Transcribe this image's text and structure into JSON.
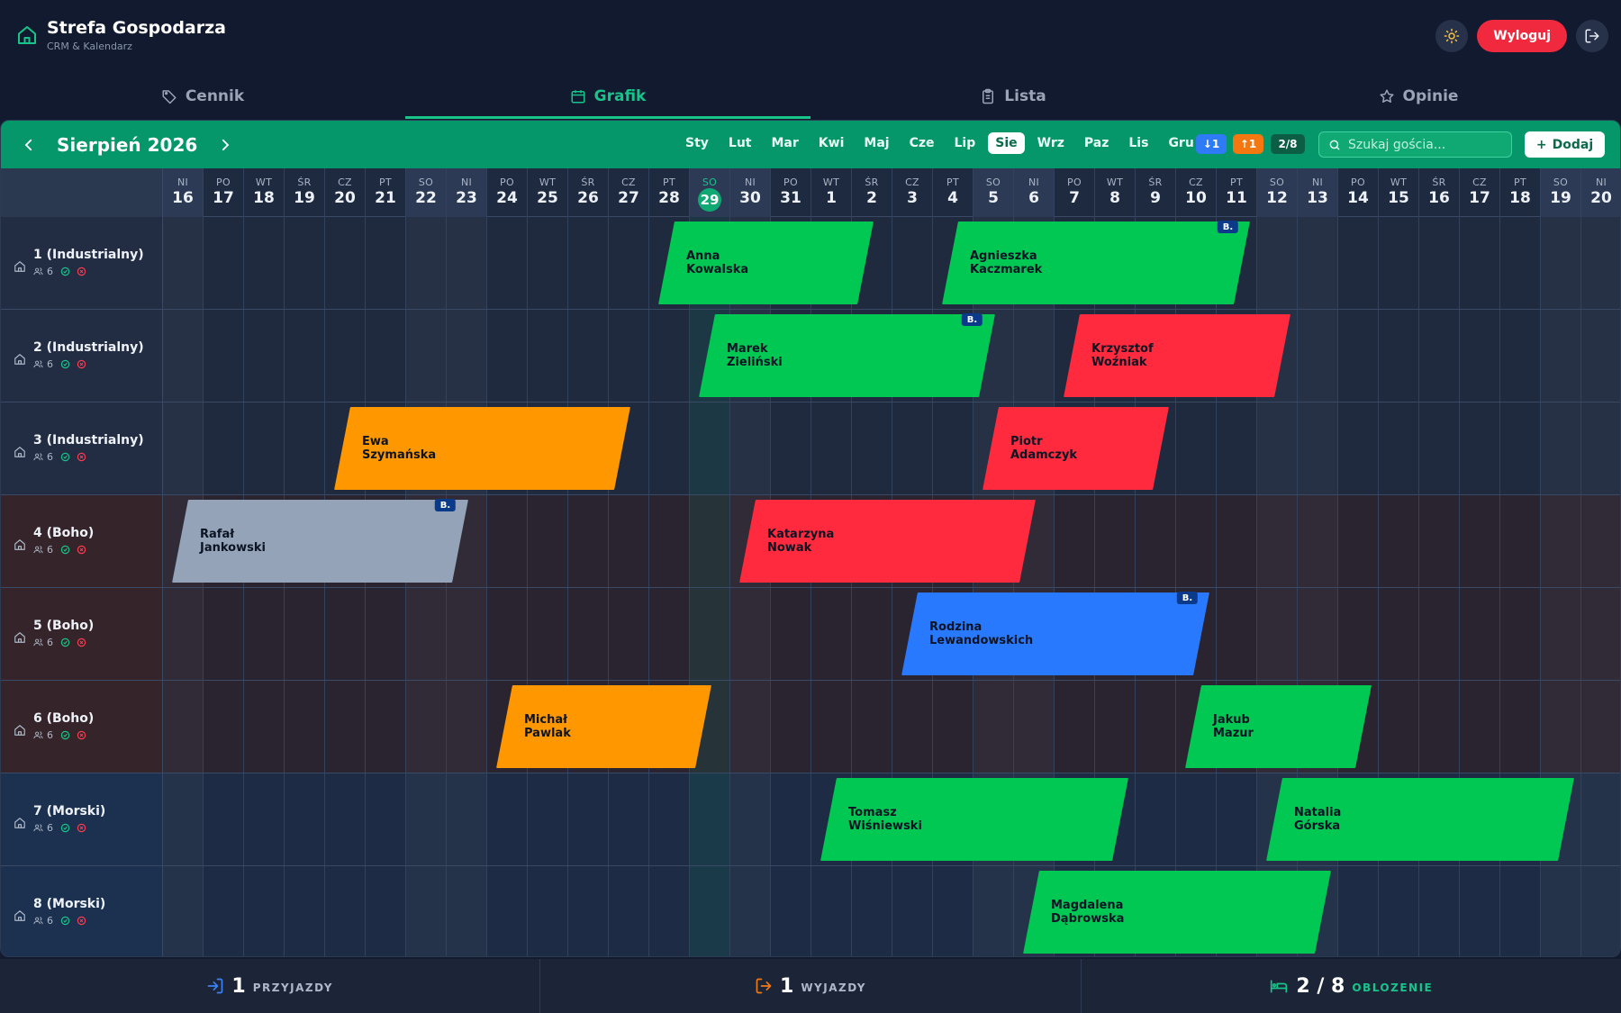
{
  "app": {
    "title": "Strefa Gospodarza",
    "subtitle": "CRM & Kalendarz",
    "logout_label": "Wyloguj"
  },
  "tabs": [
    {
      "label": "Cennik",
      "icon": "tag-icon",
      "active": false
    },
    {
      "label": "Grafik",
      "icon": "calendar-icon",
      "active": true
    },
    {
      "label": "Lista",
      "icon": "clipboard-icon",
      "active": false
    },
    {
      "label": "Opinie",
      "icon": "star-icon",
      "active": false
    }
  ],
  "toolbar": {
    "month_title": "Sierpień 2026",
    "months": [
      "Sty",
      "Lut",
      "Mar",
      "Kwi",
      "Maj",
      "Cze",
      "Lip",
      "Sie",
      "Wrz",
      "Paz",
      "Lis",
      "Gru"
    ],
    "active_month": "Sie",
    "chips": {
      "arrivals": "↓1",
      "departures": "↑1",
      "occupancy": "2/8"
    },
    "chip_colors": {
      "arrivals": "#2f7bf5",
      "departures": "#f4770f",
      "occupancy": "#0b5e43"
    },
    "search_placeholder": "Szukaj gościa...",
    "add_label": "Dodaj"
  },
  "days": [
    {
      "n": "NI",
      "d": "16",
      "we": true
    },
    {
      "n": "PO",
      "d": "17"
    },
    {
      "n": "WT",
      "d": "18"
    },
    {
      "n": "ŚR",
      "d": "19"
    },
    {
      "n": "CZ",
      "d": "20"
    },
    {
      "n": "PT",
      "d": "21"
    },
    {
      "n": "SO",
      "d": "22",
      "we": true
    },
    {
      "n": "NI",
      "d": "23",
      "we": true
    },
    {
      "n": "PO",
      "d": "24"
    },
    {
      "n": "WT",
      "d": "25"
    },
    {
      "n": "ŚR",
      "d": "26"
    },
    {
      "n": "CZ",
      "d": "27"
    },
    {
      "n": "PT",
      "d": "28"
    },
    {
      "n": "SO",
      "d": "29",
      "we": true,
      "today": true
    },
    {
      "n": "NI",
      "d": "30",
      "we": true
    },
    {
      "n": "PO",
      "d": "31"
    },
    {
      "n": "WT",
      "d": "1"
    },
    {
      "n": "ŚR",
      "d": "2"
    },
    {
      "n": "CZ",
      "d": "3"
    },
    {
      "n": "PT",
      "d": "4"
    },
    {
      "n": "SO",
      "d": "5",
      "we": true
    },
    {
      "n": "NI",
      "d": "6",
      "we": true
    },
    {
      "n": "PO",
      "d": "7"
    },
    {
      "n": "WT",
      "d": "8"
    },
    {
      "n": "ŚR",
      "d": "9"
    },
    {
      "n": "CZ",
      "d": "10"
    },
    {
      "n": "PT",
      "d": "11"
    },
    {
      "n": "SO",
      "d": "12",
      "we": true
    },
    {
      "n": "NI",
      "d": "13",
      "we": true
    },
    {
      "n": "PO",
      "d": "14"
    },
    {
      "n": "WT",
      "d": "15"
    },
    {
      "n": "ŚR",
      "d": "16"
    },
    {
      "n": "CZ",
      "d": "17"
    },
    {
      "n": "PT",
      "d": "18"
    },
    {
      "n": "SO",
      "d": "19",
      "we": true
    },
    {
      "n": "NI",
      "d": "20",
      "we": true
    }
  ],
  "rooms": [
    {
      "name": "1 (Industrialny)",
      "guests": "6",
      "theme": "ind"
    },
    {
      "name": "2 (Industrialny)",
      "guests": "6",
      "theme": "ind"
    },
    {
      "name": "3 (Industrialny)",
      "guests": "6",
      "theme": "ind"
    },
    {
      "name": "4 (Boho)",
      "guests": "6",
      "theme": "boho"
    },
    {
      "name": "5 (Boho)",
      "guests": "6",
      "theme": "boho"
    },
    {
      "name": "6 (Boho)",
      "guests": "6",
      "theme": "boho"
    },
    {
      "name": "7 (Morski)",
      "guests": "6",
      "theme": "mor"
    },
    {
      "name": "8 (Morski)",
      "guests": "6",
      "theme": "mor"
    }
  ],
  "bookings": [
    {
      "room": 0,
      "start": 12.2,
      "end": 17.1,
      "name": "Anna\nKowalska",
      "color": "#00c853",
      "badge": ""
    },
    {
      "room": 0,
      "start": 19.2,
      "end": 26.4,
      "name": "Agnieszka\nKaczmarek",
      "color": "#00c853",
      "badge": "B."
    },
    {
      "room": 1,
      "start": 13.2,
      "end": 20.1,
      "name": "Marek\nZieliński",
      "color": "#00c853",
      "badge": "B."
    },
    {
      "room": 1,
      "start": 22.2,
      "end": 27.4,
      "name": "Krzysztof\nWoźniak",
      "color": "#ff2a3d",
      "badge": ""
    },
    {
      "room": 2,
      "start": 4.2,
      "end": 11.1,
      "name": "Ewa\nSzymańska",
      "color": "#ff9800",
      "badge": ""
    },
    {
      "room": 2,
      "start": 20.2,
      "end": 24.4,
      "name": "Piotr\nAdamczyk",
      "color": "#ff2a3d",
      "badge": ""
    },
    {
      "room": 3,
      "start": 0.2,
      "end": 7.1,
      "name": "Rafał\nJankowski",
      "color": "#94a3b8",
      "badge": "B."
    },
    {
      "room": 3,
      "start": 14.2,
      "end": 21.1,
      "name": "Katarzyna\nNowak",
      "color": "#ff2a3d",
      "badge": ""
    },
    {
      "room": 4,
      "start": 18.2,
      "end": 25.4,
      "name": "Rodzina\nLewandowskich",
      "color": "#2979ff",
      "badge": "B."
    },
    {
      "room": 5,
      "start": 8.2,
      "end": 13.1,
      "name": "Michał\nPawlak",
      "color": "#ff9800",
      "badge": ""
    },
    {
      "room": 5,
      "start": 25.2,
      "end": 29.4,
      "name": "Jakub\nMazur",
      "color": "#00c853",
      "badge": ""
    },
    {
      "room": 6,
      "start": 16.2,
      "end": 23.4,
      "name": "Tomasz\nWiśniewski",
      "color": "#00c853",
      "badge": ""
    },
    {
      "room": 6,
      "start": 27.2,
      "end": 34.4,
      "name": "Natalia\nGórska",
      "color": "#00c853",
      "badge": ""
    },
    {
      "room": 7,
      "start": 21.2,
      "end": 28.4,
      "name": "Magdalena\nDąbrowska",
      "color": "#00c853",
      "badge": ""
    }
  ],
  "footer": {
    "arrivals": {
      "value": "1",
      "label": "PRZYJAZDY"
    },
    "departures": {
      "value": "1",
      "label": "WYJAZDY"
    },
    "occupancy": {
      "value": "2 / 8",
      "label": "OBLOZENIE"
    }
  },
  "colors": {
    "accent": "#10a873",
    "danger": "#f0293e"
  }
}
